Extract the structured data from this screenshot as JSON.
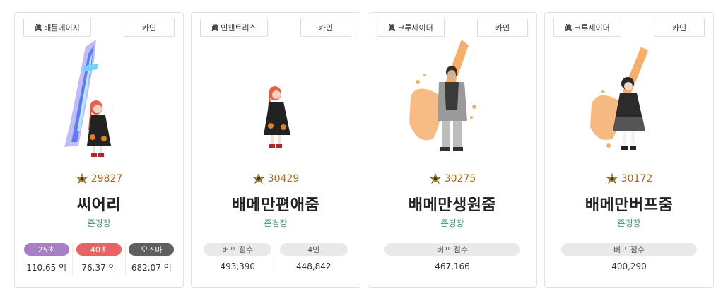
{
  "cards": [
    {
      "job": "배틀메이지",
      "server": "카인",
      "fame": "29827",
      "name": "씨어리",
      "adventure": "존경장",
      "damage": [
        {
          "label": "25초",
          "value": "110.65 억",
          "color": "#a87fc4"
        },
        {
          "label": "40초",
          "value": "76.37 억",
          "color": "#e66464"
        },
        {
          "label": "오즈마",
          "value": "682.07 억",
          "color": "#5f5f5f"
        }
      ]
    },
    {
      "job": "인챈트리스",
      "server": "카인",
      "fame": "30429",
      "name": "배메만편애줌",
      "adventure": "존경장",
      "buffs": [
        {
          "label": "버프 점수",
          "value": "493,390"
        },
        {
          "label": "4인",
          "value": "448,842"
        }
      ]
    },
    {
      "job": "크루세이더",
      "server": "카인",
      "fame": "30275",
      "name": "배메만생원줌",
      "adventure": "존경장",
      "buffs": [
        {
          "label": "버프 점수",
          "value": "467,166"
        }
      ]
    },
    {
      "job": "크루세이더",
      "server": "카인",
      "fame": "30172",
      "name": "배메만버프줌",
      "adventure": "존경장",
      "buffs": [
        {
          "label": "버프 점수",
          "value": "400,290"
        }
      ]
    }
  ],
  "icons": {
    "job_badge": "true-awakening-icon",
    "fame": "fame-laurel-icon"
  },
  "badge_glyph": "眞",
  "colors": {
    "fame_text": "#a56a1a",
    "adventure_text": "#3f8f78",
    "pill_gray": "#e9e9e9"
  }
}
